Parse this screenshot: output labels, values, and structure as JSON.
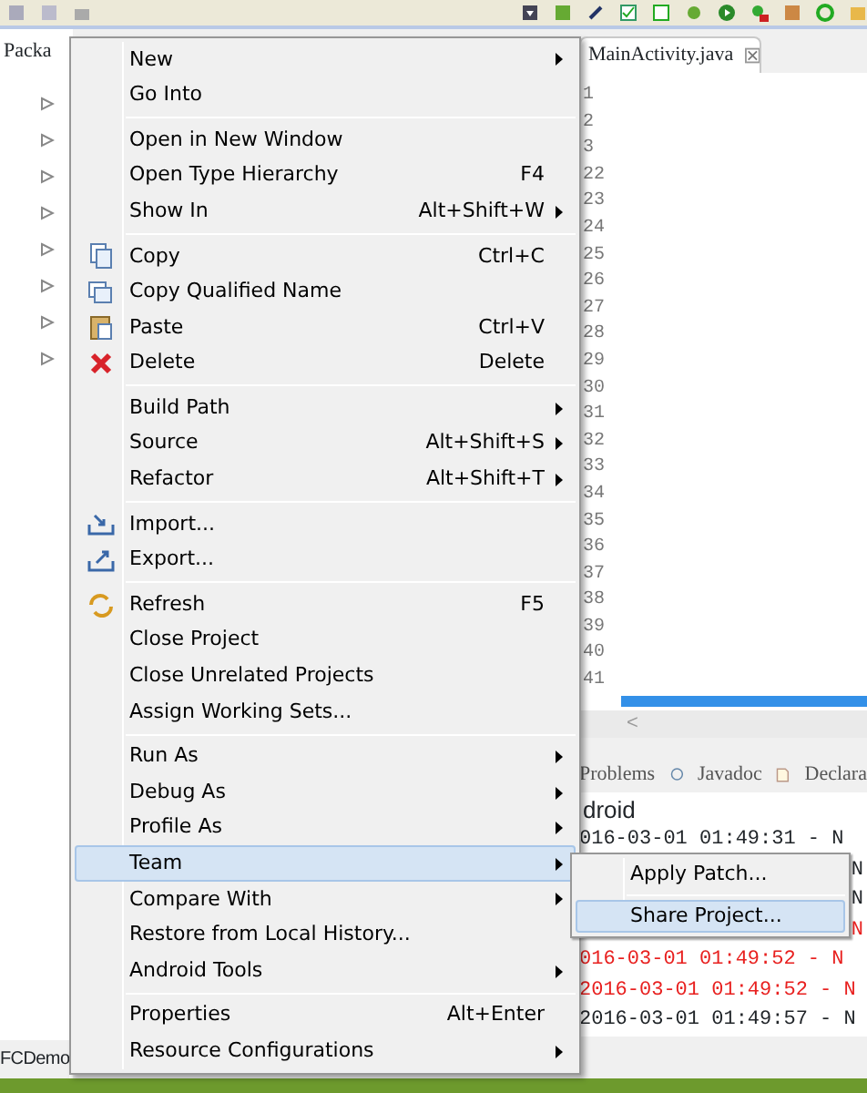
{
  "explorer": {
    "tab_label": "Packa",
    "project_label": "FCDemo"
  },
  "editor": {
    "tab_label": "MainActivity.java",
    "line_numbers": [
      "1",
      "2",
      "3",
      "22",
      "23",
      "24",
      "25",
      "26",
      "27",
      "28",
      "29",
      "30",
      "31",
      "32",
      "33",
      "34",
      "35",
      "36",
      "37",
      "38",
      "39",
      "40",
      "41"
    ],
    "scroll_left": "<"
  },
  "console": {
    "tabs": [
      "Problems",
      "Javadoc",
      "Declara"
    ],
    "header": "droid",
    "lines": [
      {
        "text": "016-03-01 01:49:31 - N",
        "kind": "full",
        "error": false
      },
      {
        "text": "N",
        "kind": "tail",
        "error": false
      },
      {
        "text": "N",
        "kind": "tail",
        "error": false
      },
      {
        "text": "N",
        "kind": "tail",
        "error": true
      },
      {
        "text": "016-03-01 01:49:52 - N",
        "kind": "full",
        "error": true
      },
      {
        "text": "2016-03-01 01:49:52 - N",
        "kind": "full",
        "error": true
      },
      {
        "text": "2016-03-01 01:49:57 - N",
        "kind": "full",
        "error": false
      }
    ]
  },
  "context_menu": {
    "sections": [
      [
        {
          "label": "New",
          "submenu": true,
          "selected": false
        },
        {
          "label": "Go Into",
          "submenu": false,
          "selected": false
        }
      ],
      [
        {
          "label": "Open in New Window",
          "submenu": false,
          "selected": false
        },
        {
          "label": "Open Type Hierarchy",
          "shortcut": "F4",
          "submenu": false,
          "selected": false
        },
        {
          "label": "Show In",
          "shortcut": "Alt+Shift+W",
          "submenu": true,
          "selected": false
        }
      ],
      [
        {
          "label": "Copy",
          "shortcut": "Ctrl+C",
          "submenu": false,
          "selected": false
        },
        {
          "label": "Copy Qualified Name",
          "submenu": false,
          "selected": false
        },
        {
          "label": "Paste",
          "shortcut": "Ctrl+V",
          "submenu": false,
          "selected": false
        },
        {
          "label": "Delete",
          "shortcut": "Delete",
          "submenu": false,
          "selected": false
        }
      ],
      [
        {
          "label": "Build Path",
          "submenu": true,
          "selected": false
        },
        {
          "label": "Source",
          "shortcut": "Alt+Shift+S",
          "submenu": true,
          "selected": false
        },
        {
          "label": "Refactor",
          "shortcut": "Alt+Shift+T",
          "submenu": true,
          "selected": false
        }
      ],
      [
        {
          "label": "Import...",
          "submenu": false,
          "selected": false
        },
        {
          "label": "Export...",
          "submenu": false,
          "selected": false
        }
      ],
      [
        {
          "label": "Refresh",
          "shortcut": "F5",
          "submenu": false,
          "selected": false
        },
        {
          "label": "Close Project",
          "submenu": false,
          "selected": false
        },
        {
          "label": "Close Unrelated Projects",
          "submenu": false,
          "selected": false
        },
        {
          "label": "Assign Working Sets...",
          "submenu": false,
          "selected": false
        }
      ],
      [
        {
          "label": "Run As",
          "submenu": true,
          "selected": false
        },
        {
          "label": "Debug As",
          "submenu": true,
          "selected": false
        },
        {
          "label": "Profile As",
          "submenu": true,
          "selected": false
        },
        {
          "label": "Team",
          "submenu": true,
          "selected": true
        },
        {
          "label": "Compare With",
          "submenu": true,
          "selected": false
        },
        {
          "label": "Restore from Local History...",
          "submenu": false,
          "selected": false
        },
        {
          "label": "Android Tools",
          "submenu": true,
          "selected": false
        }
      ],
      [
        {
          "label": "Properties",
          "shortcut": "Alt+Enter",
          "submenu": false,
          "selected": false
        },
        {
          "label": "Resource Configurations",
          "submenu": true,
          "selected": false
        }
      ]
    ]
  },
  "submenu": {
    "sections": [
      [
        {
          "label": "Apply Patch...",
          "submenu": false,
          "selected": false
        }
      ],
      [
        {
          "label": "Share Project...",
          "submenu": false,
          "selected": true
        }
      ]
    ]
  }
}
